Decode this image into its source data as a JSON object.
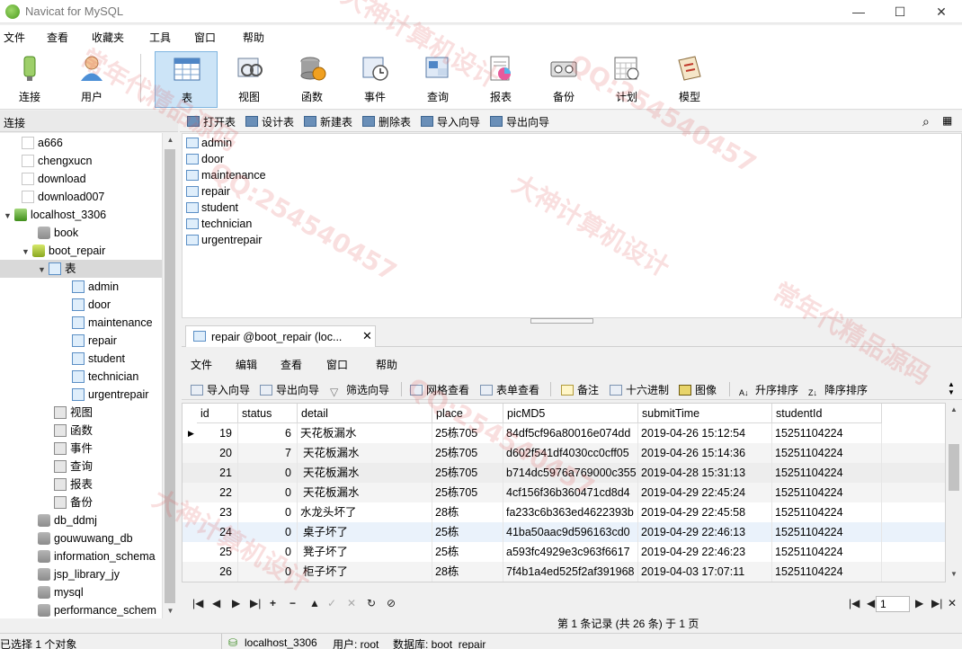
{
  "window": {
    "title": "Navicat for MySQL",
    "controls": [
      "—",
      "☐",
      "✕"
    ]
  },
  "menubar": [
    "文件",
    "查看",
    "收藏夹",
    "工具",
    "窗口",
    "帮助"
  ],
  "toolbar": [
    {
      "label": "连接",
      "icon": "connection-icon"
    },
    {
      "label": "用户",
      "icon": "user-icon"
    },
    {
      "label": "表",
      "icon": "table-icon"
    },
    {
      "label": "视图",
      "icon": "view-icon"
    },
    {
      "label": "函数",
      "icon": "function-icon"
    },
    {
      "label": "事件",
      "icon": "event-icon"
    },
    {
      "label": "查询",
      "icon": "query-icon"
    },
    {
      "label": "报表",
      "icon": "report-icon"
    },
    {
      "label": "备份",
      "icon": "backup-icon"
    },
    {
      "label": "计划",
      "icon": "schedule-icon"
    },
    {
      "label": "模型",
      "icon": "model-icon"
    }
  ],
  "active_tool": "表",
  "left_header": "连接",
  "object_toolbar": [
    "打开表",
    "设计表",
    "新建表",
    "删除表",
    "导入向导",
    "导出向导"
  ],
  "tree": {
    "items": [
      {
        "label": "a666",
        "icon": "file"
      },
      {
        "label": "chengxucn",
        "icon": "file"
      },
      {
        "label": "download",
        "icon": "file"
      },
      {
        "label": "download007",
        "icon": "file"
      },
      {
        "label": "localhost_3306",
        "icon": "conn"
      },
      {
        "label": "book",
        "icon": "db"
      },
      {
        "label": "boot_repair",
        "icon": "dbopen"
      },
      {
        "label": "表",
        "icon": "tbl"
      },
      {
        "label": "admin",
        "icon": "tbl"
      },
      {
        "label": "door",
        "icon": "tbl"
      },
      {
        "label": "maintenance",
        "icon": "tbl"
      },
      {
        "label": "repair",
        "icon": "tbl"
      },
      {
        "label": "student",
        "icon": "tbl"
      },
      {
        "label": "technician",
        "icon": "tbl"
      },
      {
        "label": "urgentrepair",
        "icon": "tbl"
      },
      {
        "label": "视图",
        "icon": "misc"
      },
      {
        "label": "函数",
        "icon": "misc"
      },
      {
        "label": "事件",
        "icon": "misc"
      },
      {
        "label": "查询",
        "icon": "misc"
      },
      {
        "label": "报表",
        "icon": "misc"
      },
      {
        "label": "备份",
        "icon": "misc"
      },
      {
        "label": "db_ddmj",
        "icon": "db"
      },
      {
        "label": "gouwuwang_db",
        "icon": "db"
      },
      {
        "label": "information_schema",
        "icon": "db"
      },
      {
        "label": "jsp_library_jy",
        "icon": "db"
      },
      {
        "label": "mysql",
        "icon": "db"
      },
      {
        "label": "performance_schem",
        "icon": "db"
      }
    ]
  },
  "object_list": [
    "admin",
    "door",
    "maintenance",
    "repair",
    "student",
    "technician",
    "urgentrepair"
  ],
  "tab": {
    "title": "repair @boot_repair (loc...",
    "close": "✕"
  },
  "inner_menu": [
    "文件",
    "编辑",
    "查看",
    "窗口",
    "帮助"
  ],
  "inner_toolbar": [
    "导入向导",
    "导出向导",
    "筛选向导",
    "网格查看",
    "表单查看",
    "备注",
    "十六进制",
    "图像",
    "升序排序",
    "降序排序"
  ],
  "grid": {
    "columns": [
      "id",
      "status",
      "detail",
      "place",
      "picMD5",
      "submitTime",
      "studentId"
    ],
    "rows": [
      [
        "19",
        "6",
        "天花板漏水",
        "25栋705",
        "84df5cf96a80016e074dd",
        "2019-04-26 15:12:54",
        "15251104224"
      ],
      [
        "20",
        "7",
        "天花板漏水",
        "25栋705",
        "d602f541df4030cc0cff05",
        "2019-04-26 15:14:36",
        "15251104224"
      ],
      [
        "21",
        "0",
        "天花板漏水",
        "25栋705",
        "b714dc5976a769000c355",
        "2019-04-28 15:31:13",
        "15251104224"
      ],
      [
        "22",
        "0",
        "天花板漏水",
        "25栋705",
        "4cf156f36b360471cd8d4",
        "2019-04-29 22:45:24",
        "15251104224"
      ],
      [
        "23",
        "0",
        "水龙头坏了",
        "28栋",
        "fa233c6b363ed4622393b",
        "2019-04-29 22:45:58",
        "15251104224"
      ],
      [
        "24",
        "0",
        "桌子坏了",
        "25栋",
        "41ba50aac9d596163cd0",
        "2019-04-29 22:46:13",
        "15251104224"
      ],
      [
        "25",
        "0",
        "凳子坏了",
        "25栋",
        "a593fc4929e3c963f6617",
        "2019-04-29 22:46:23",
        "15251104224"
      ],
      [
        "26",
        "0",
        "柜子坏了",
        "28栋",
        "7f4b1a4ed525f2af391968",
        "2019-04-03 17:07:11",
        "15251104224"
      ]
    ]
  },
  "nav_buttons": [
    "|◀",
    "◀",
    "▶",
    "▶|",
    "+",
    "−",
    "▲",
    "✓",
    "✕",
    "↻",
    "⊘"
  ],
  "page": {
    "value": "1",
    "first": "|◀",
    "prev": "◀",
    "next": "▶",
    "last": "▶|"
  },
  "record_info": "第 1 条记录 (共 26 条) 于 1 页",
  "status": {
    "selection": "已选择 1 个对象",
    "connection": "localhost_3306",
    "user": "用户: root",
    "database": "数据库: boot_repair"
  },
  "watermarks": [
    "大神计算机设计",
    "QQ:254540457",
    "常年代精品源码",
    "QQ:254540457",
    "大神计算机设计",
    "常年代精品源码",
    "QQ:254540457",
    "大神计算机设计"
  ],
  "colors": {
    "accent": "#cce4f7",
    "selection": "#d9d9d9",
    "watermark": "#dc5050"
  }
}
